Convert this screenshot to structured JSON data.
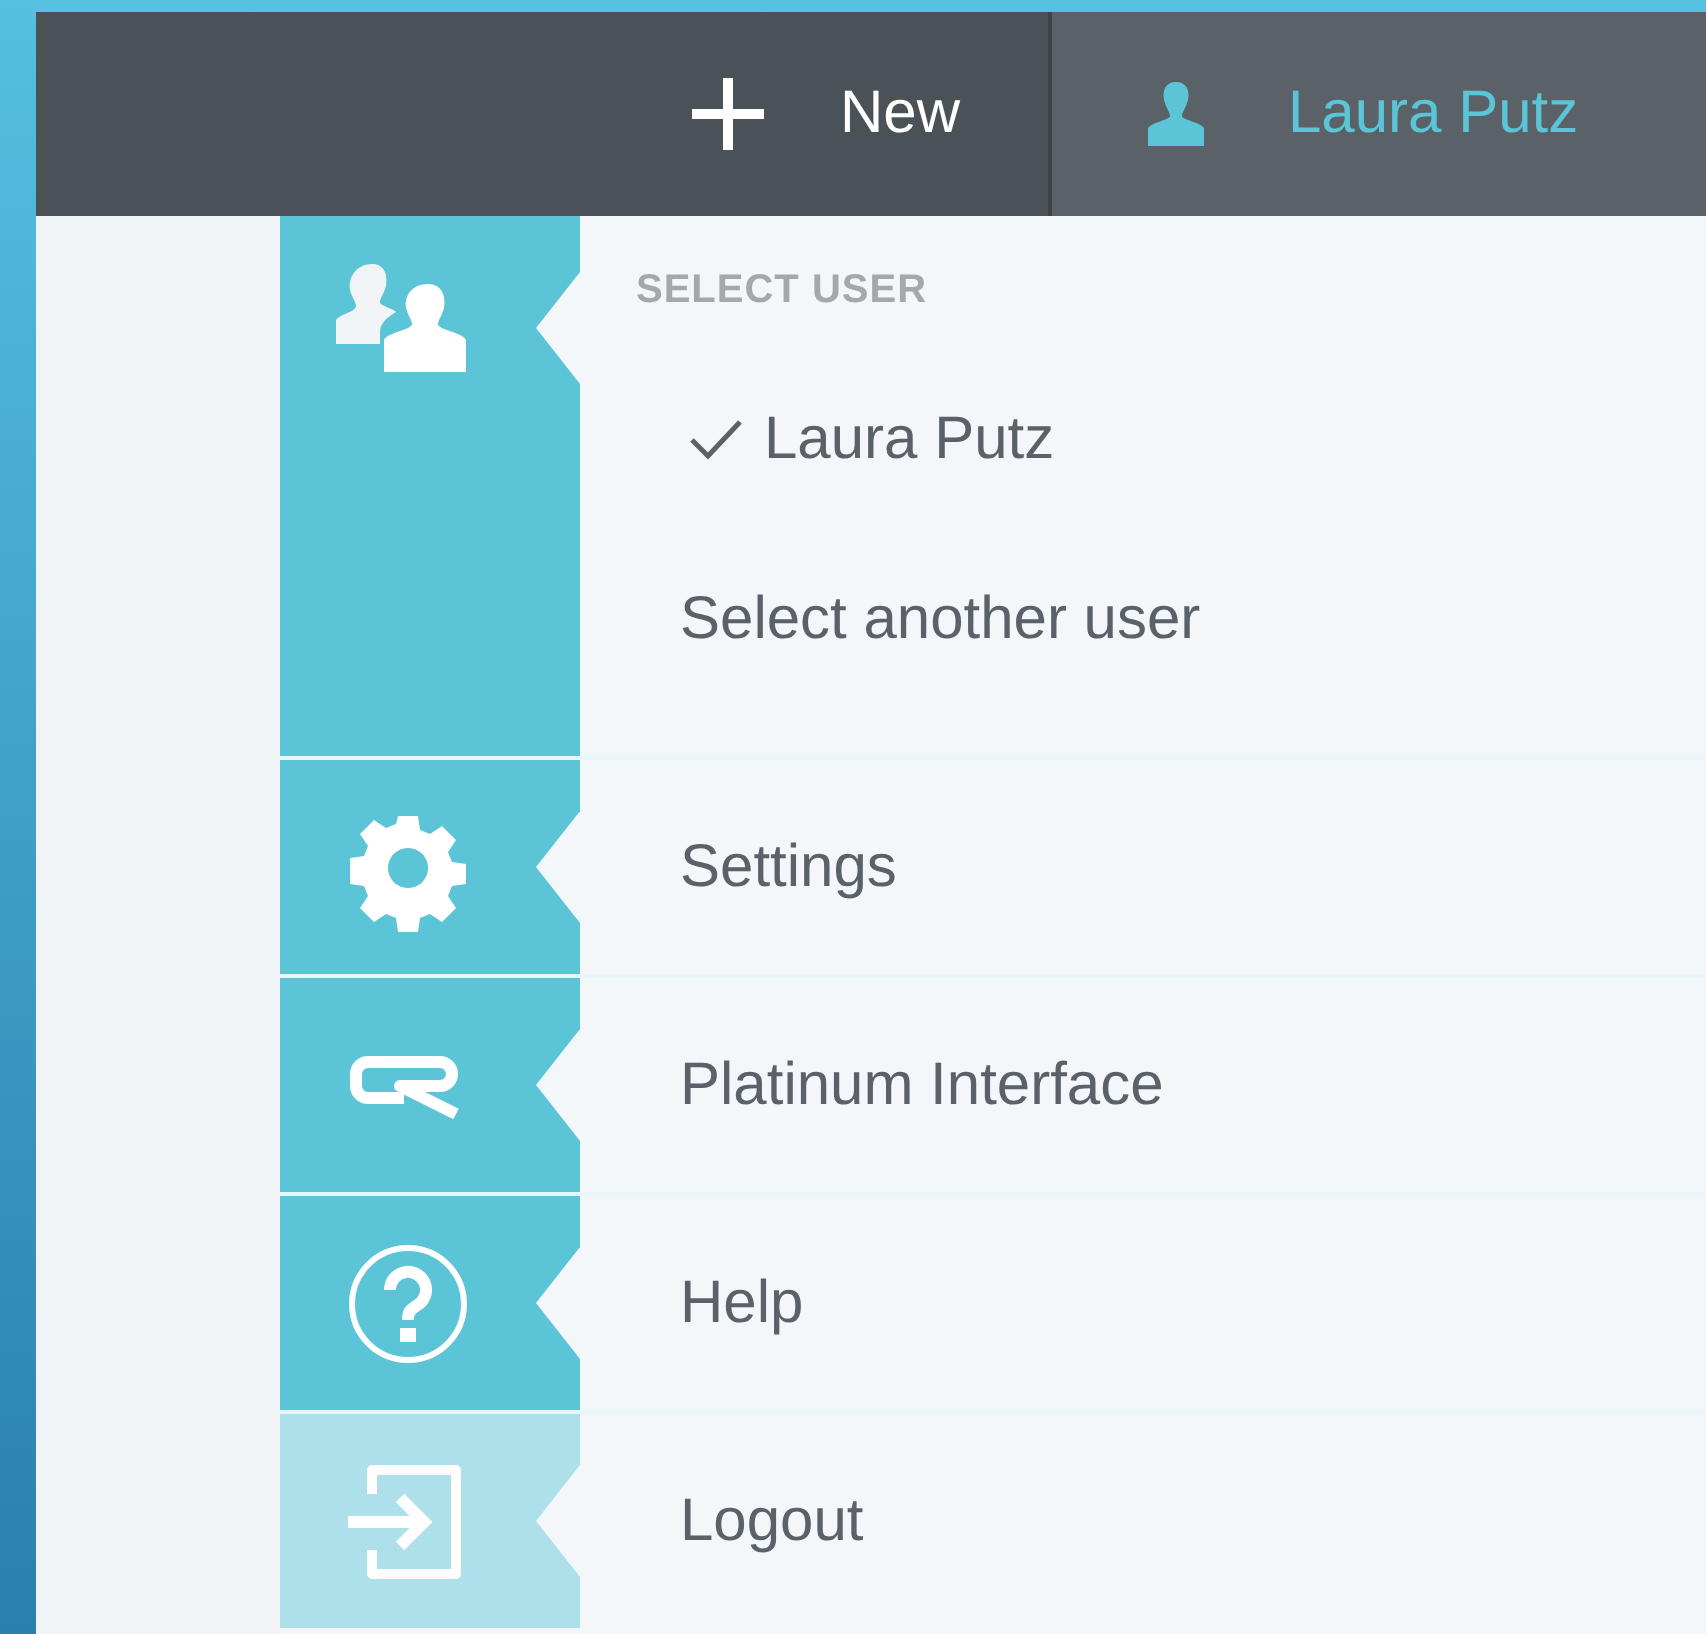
{
  "top_bar": {
    "new_button": {
      "label": "New"
    },
    "user_button": {
      "label": "Laura Putz"
    }
  },
  "menu": {
    "user_section": {
      "heading": "SELECT USER",
      "users": [
        {
          "label": "Laura Putz",
          "selected": true
        },
        {
          "label": "Select another user",
          "selected": false
        }
      ]
    },
    "items": [
      {
        "kind": "gear",
        "label": "Settings",
        "dimmed": false
      },
      {
        "kind": "logo",
        "label": "Platinum Interface",
        "dimmed": false
      },
      {
        "kind": "help",
        "label": "Help",
        "dimmed": false
      },
      {
        "kind": "logout",
        "label": "Logout",
        "dimmed": true
      }
    ]
  }
}
